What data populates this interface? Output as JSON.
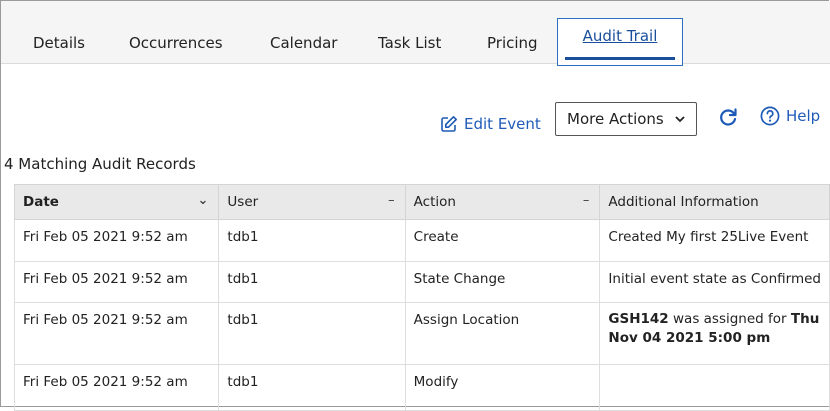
{
  "tabs": [
    {
      "label": "Details"
    },
    {
      "label": "Occurrences"
    },
    {
      "label": "Calendar"
    },
    {
      "label": "Task List"
    },
    {
      "label": "Pricing"
    },
    {
      "label": "Audit Trail",
      "active": true
    }
  ],
  "toolbar": {
    "edit_label": "Edit Event",
    "more_actions_label": "More Actions",
    "help_label": "Help"
  },
  "audit": {
    "count_text": "4 Matching Audit Records",
    "columns": [
      {
        "label": "Date",
        "sort": "descending"
      },
      {
        "label": "User"
      },
      {
        "label": "Action"
      },
      {
        "label": "Additional Information"
      }
    ],
    "sort_symbol_date": "⌄",
    "sort_symbol_other": "–",
    "rows": [
      {
        "date": "Fri Feb 05 2021 9:52 am",
        "user": "tdb1",
        "action": "Create",
        "info": "Created My first 25Live Event"
      },
      {
        "date": "Fri Feb 05 2021 9:52 am",
        "user": "tdb1",
        "action": "State Change",
        "info": "Initial event state as Confirmed"
      },
      {
        "date": "Fri Feb 05 2021 9:52 am",
        "user": "tdb1",
        "action": "Assign Location",
        "info_location": "GSH142",
        "info_middle": " was assigned for ",
        "info_time": "Thu Nov 04 2021 5:00 pm"
      },
      {
        "date": "Fri Feb 05 2021 9:52 am",
        "user": "tdb1",
        "action": "Modify",
        "info": ""
      }
    ]
  },
  "colors": {
    "link": "#1e5bb8",
    "active_tab": "#1a4f9b",
    "header_bg": "#e9e9e9"
  }
}
